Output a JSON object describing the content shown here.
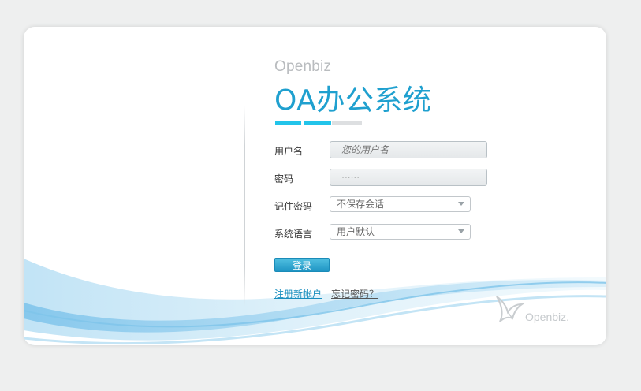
{
  "header": {
    "brand_small": "Openbiz",
    "title": "OA办公系统"
  },
  "form": {
    "username_label": "用户名",
    "username_placeholder": "您的用户名",
    "password_label": "密码",
    "password_placeholder": "······",
    "remember_label": "记住密码",
    "remember_value": "不保存会话",
    "language_label": "系统语言",
    "language_value": "用户默认",
    "login_button": "登录"
  },
  "links": {
    "register": "注册新帐户",
    "forgot": "忘记密码？"
  },
  "footer_logo": {
    "text": "Openbiz."
  },
  "colors": {
    "accent": "#1fa0cf",
    "progress": "#22c4ea",
    "background": "#eeefef"
  }
}
